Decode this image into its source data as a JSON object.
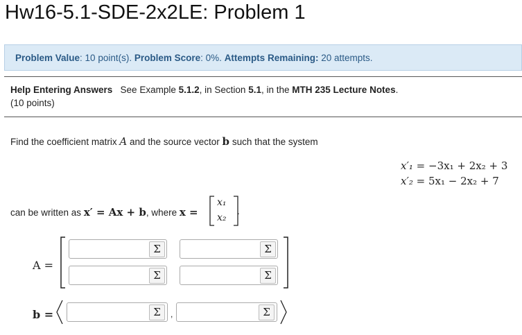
{
  "page": {
    "title": "Hw16-5.1-SDE-2x2LE: Problem 1"
  },
  "info": {
    "value_label": "Problem Value",
    "value_text": ": 10 point(s).",
    "score_label": "Problem Score",
    "score_text": ": 0%.",
    "attempts_label": "Attempts Remaining:",
    "attempts_text": "20 attempts."
  },
  "help": {
    "link": "Help Entering Answers",
    "see": "See Example",
    "example": "5.1.2",
    "in_section": ", in Section",
    "section": "5.1",
    "in_the": ", in the",
    "notes": "MTH 235 Lecture Notes",
    "end": ".",
    "points": "(10 points)"
  },
  "problem": {
    "p1": "Find the coefficient matrix",
    "A": "A",
    "p2": "and the source vector",
    "b": "b",
    "p3": "such that the system",
    "eq1_lhs": "x′₁",
    "eq1_rhs": "= −3x₁ + 2x₂ + 3",
    "eq2_lhs": "x′₂",
    "eq2_rhs": "= 5x₁ − 2x₂ + 7",
    "written_as": "can be written as",
    "eq_main": "x′ = Ax + b",
    "where": ", where",
    "x_eq": "x =",
    "x_top": "x₁",
    "x_bot": "x₂",
    "dot": "."
  },
  "answer": {
    "A_label": "A =",
    "b_label": "b =",
    "sigma": "Σ",
    "comma": ","
  }
}
